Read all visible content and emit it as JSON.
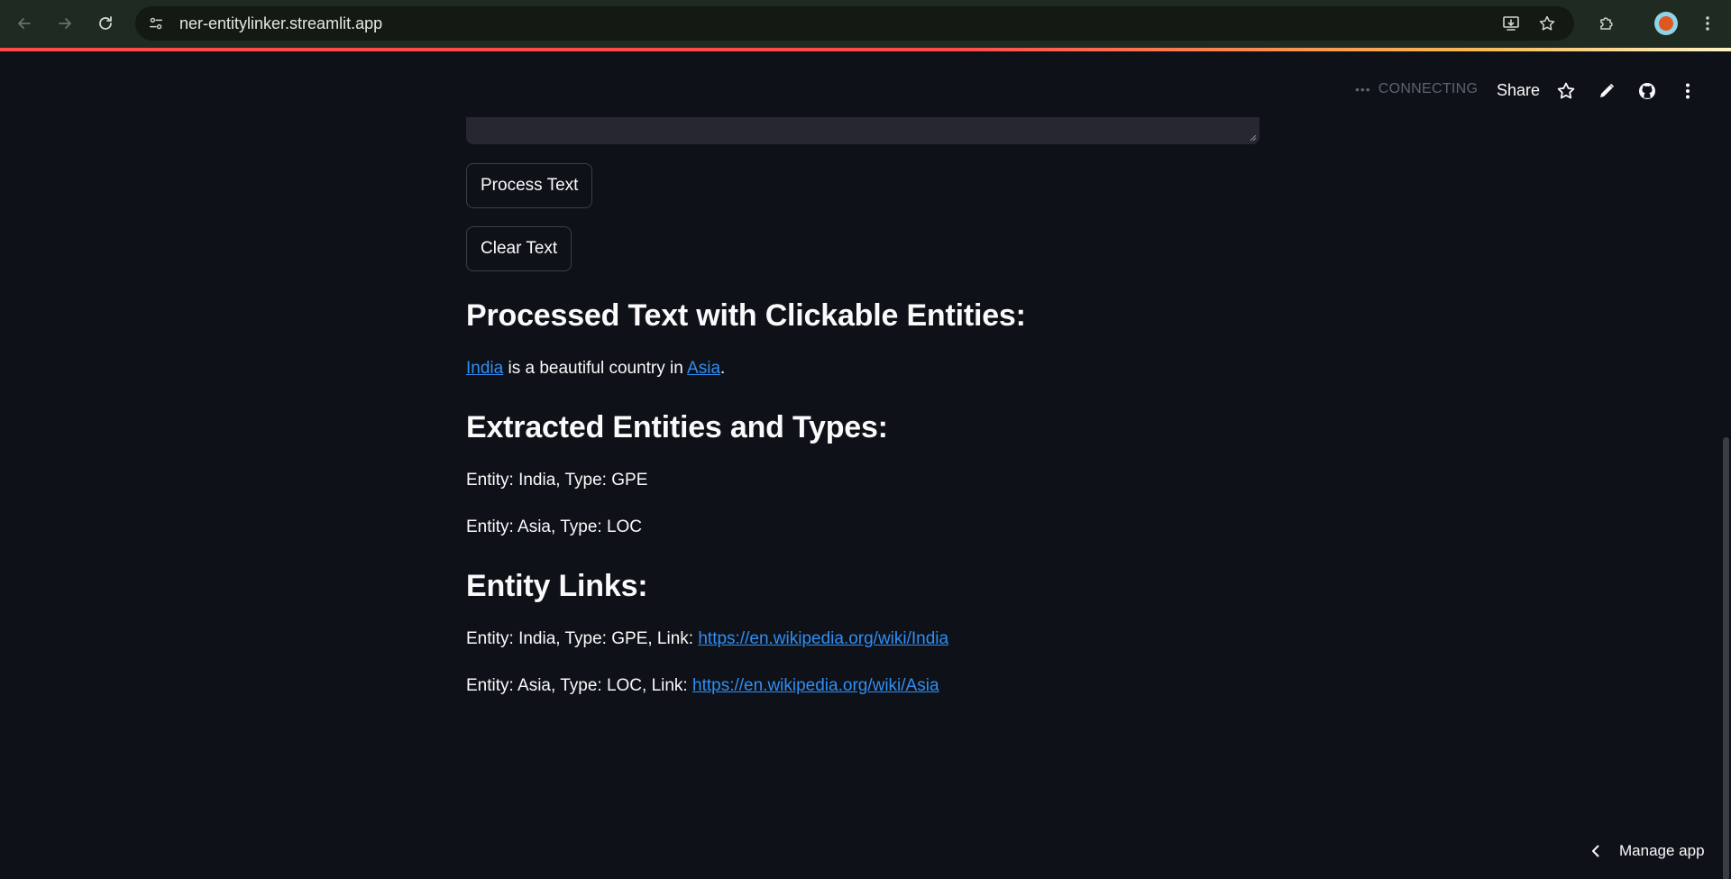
{
  "browser": {
    "url": "ner-entitylinker.streamlit.app"
  },
  "header": {
    "status": "CONNECTING",
    "share_label": "Share"
  },
  "buttons": {
    "process": "Process Text",
    "clear": "Clear Text"
  },
  "sections": {
    "processed_title": "Processed Text with Clickable Entities:",
    "processed_text": {
      "entity1": "India",
      "middle": " is a beautiful country in ",
      "entity2": "Asia",
      "end": "."
    },
    "extracted_title": "Extracted Entities and Types:",
    "extracted": [
      "Entity: India, Type: GPE",
      "Entity: Asia, Type: LOC"
    ],
    "links_title": "Entity Links:",
    "links": [
      {
        "prefix": "Entity: India, Type: GPE, Link: ",
        "url": "https://en.wikipedia.org/wiki/India"
      },
      {
        "prefix": "Entity: Asia, Type: LOC, Link: ",
        "url": "https://en.wikipedia.org/wiki/Asia"
      }
    ]
  },
  "footer": {
    "manage_label": "Manage app"
  },
  "colors": {
    "background": "#0e1117",
    "link": "#2f8ff5",
    "accent": "#ff4b4b"
  }
}
